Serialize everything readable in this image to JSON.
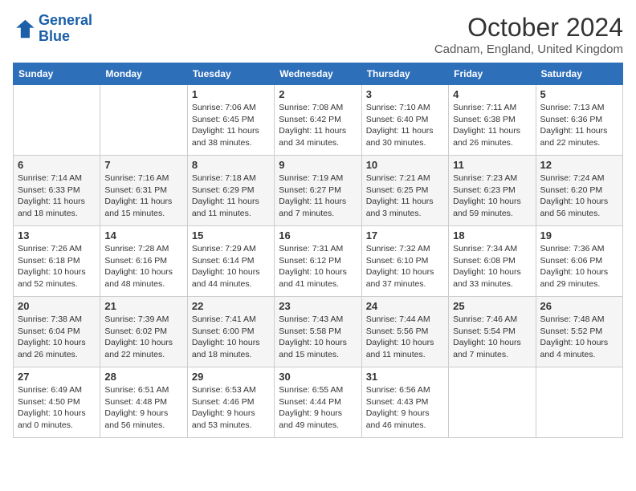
{
  "header": {
    "logo_line1": "General",
    "logo_line2": "Blue",
    "month": "October 2024",
    "location": "Cadnam, England, United Kingdom"
  },
  "days_of_week": [
    "Sunday",
    "Monday",
    "Tuesday",
    "Wednesday",
    "Thursday",
    "Friday",
    "Saturday"
  ],
  "weeks": [
    [
      {
        "day": "",
        "detail": ""
      },
      {
        "day": "",
        "detail": ""
      },
      {
        "day": "1",
        "detail": "Sunrise: 7:06 AM\nSunset: 6:45 PM\nDaylight: 11 hours and 38 minutes."
      },
      {
        "day": "2",
        "detail": "Sunrise: 7:08 AM\nSunset: 6:42 PM\nDaylight: 11 hours and 34 minutes."
      },
      {
        "day": "3",
        "detail": "Sunrise: 7:10 AM\nSunset: 6:40 PM\nDaylight: 11 hours and 30 minutes."
      },
      {
        "day": "4",
        "detail": "Sunrise: 7:11 AM\nSunset: 6:38 PM\nDaylight: 11 hours and 26 minutes."
      },
      {
        "day": "5",
        "detail": "Sunrise: 7:13 AM\nSunset: 6:36 PM\nDaylight: 11 hours and 22 minutes."
      }
    ],
    [
      {
        "day": "6",
        "detail": "Sunrise: 7:14 AM\nSunset: 6:33 PM\nDaylight: 11 hours and 18 minutes."
      },
      {
        "day": "7",
        "detail": "Sunrise: 7:16 AM\nSunset: 6:31 PM\nDaylight: 11 hours and 15 minutes."
      },
      {
        "day": "8",
        "detail": "Sunrise: 7:18 AM\nSunset: 6:29 PM\nDaylight: 11 hours and 11 minutes."
      },
      {
        "day": "9",
        "detail": "Sunrise: 7:19 AM\nSunset: 6:27 PM\nDaylight: 11 hours and 7 minutes."
      },
      {
        "day": "10",
        "detail": "Sunrise: 7:21 AM\nSunset: 6:25 PM\nDaylight: 11 hours and 3 minutes."
      },
      {
        "day": "11",
        "detail": "Sunrise: 7:23 AM\nSunset: 6:23 PM\nDaylight: 10 hours and 59 minutes."
      },
      {
        "day": "12",
        "detail": "Sunrise: 7:24 AM\nSunset: 6:20 PM\nDaylight: 10 hours and 56 minutes."
      }
    ],
    [
      {
        "day": "13",
        "detail": "Sunrise: 7:26 AM\nSunset: 6:18 PM\nDaylight: 10 hours and 52 minutes."
      },
      {
        "day": "14",
        "detail": "Sunrise: 7:28 AM\nSunset: 6:16 PM\nDaylight: 10 hours and 48 minutes."
      },
      {
        "day": "15",
        "detail": "Sunrise: 7:29 AM\nSunset: 6:14 PM\nDaylight: 10 hours and 44 minutes."
      },
      {
        "day": "16",
        "detail": "Sunrise: 7:31 AM\nSunset: 6:12 PM\nDaylight: 10 hours and 41 minutes."
      },
      {
        "day": "17",
        "detail": "Sunrise: 7:32 AM\nSunset: 6:10 PM\nDaylight: 10 hours and 37 minutes."
      },
      {
        "day": "18",
        "detail": "Sunrise: 7:34 AM\nSunset: 6:08 PM\nDaylight: 10 hours and 33 minutes."
      },
      {
        "day": "19",
        "detail": "Sunrise: 7:36 AM\nSunset: 6:06 PM\nDaylight: 10 hours and 29 minutes."
      }
    ],
    [
      {
        "day": "20",
        "detail": "Sunrise: 7:38 AM\nSunset: 6:04 PM\nDaylight: 10 hours and 26 minutes."
      },
      {
        "day": "21",
        "detail": "Sunrise: 7:39 AM\nSunset: 6:02 PM\nDaylight: 10 hours and 22 minutes."
      },
      {
        "day": "22",
        "detail": "Sunrise: 7:41 AM\nSunset: 6:00 PM\nDaylight: 10 hours and 18 minutes."
      },
      {
        "day": "23",
        "detail": "Sunrise: 7:43 AM\nSunset: 5:58 PM\nDaylight: 10 hours and 15 minutes."
      },
      {
        "day": "24",
        "detail": "Sunrise: 7:44 AM\nSunset: 5:56 PM\nDaylight: 10 hours and 11 minutes."
      },
      {
        "day": "25",
        "detail": "Sunrise: 7:46 AM\nSunset: 5:54 PM\nDaylight: 10 hours and 7 minutes."
      },
      {
        "day": "26",
        "detail": "Sunrise: 7:48 AM\nSunset: 5:52 PM\nDaylight: 10 hours and 4 minutes."
      }
    ],
    [
      {
        "day": "27",
        "detail": "Sunrise: 6:49 AM\nSunset: 4:50 PM\nDaylight: 10 hours and 0 minutes."
      },
      {
        "day": "28",
        "detail": "Sunrise: 6:51 AM\nSunset: 4:48 PM\nDaylight: 9 hours and 56 minutes."
      },
      {
        "day": "29",
        "detail": "Sunrise: 6:53 AM\nSunset: 4:46 PM\nDaylight: 9 hours and 53 minutes."
      },
      {
        "day": "30",
        "detail": "Sunrise: 6:55 AM\nSunset: 4:44 PM\nDaylight: 9 hours and 49 minutes."
      },
      {
        "day": "31",
        "detail": "Sunrise: 6:56 AM\nSunset: 4:43 PM\nDaylight: 9 hours and 46 minutes."
      },
      {
        "day": "",
        "detail": ""
      },
      {
        "day": "",
        "detail": ""
      }
    ]
  ]
}
